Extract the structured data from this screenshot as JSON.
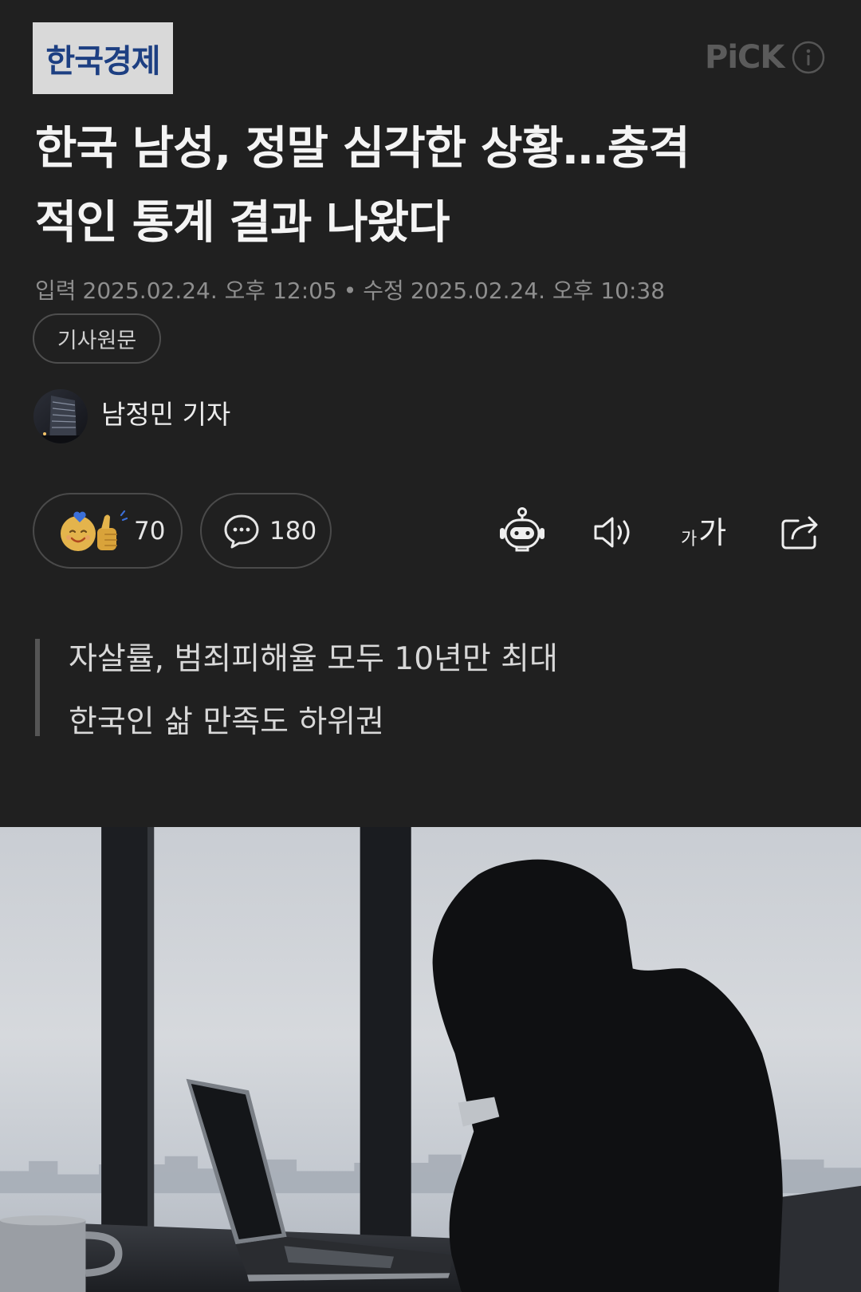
{
  "press": {
    "name": "한국경제"
  },
  "pick": {
    "label": "PiCK"
  },
  "article": {
    "title_lines": [
      "한국 남성, 정말 심각한 상황…충격",
      "적인 통계 결과 나왔다"
    ],
    "input_label": "입력",
    "input_datetime": "2025.02.24. 오후 12:05",
    "separator": "•",
    "modified_label": "수정",
    "modified_datetime": "2025.02.24. 오후 10:38",
    "original_article_label": "기사원문",
    "subtitle_lines": [
      "자살률, 범죄피해율 모두 10년만 최대",
      "한국인 삶 만족도 하위권"
    ]
  },
  "reporter": {
    "name": "남정민 기자"
  },
  "toolbar": {
    "reaction_count": "70",
    "comment_count": "180",
    "font_size_small": "가",
    "font_size_large": "가"
  },
  "icons": {
    "pick_info": "info-icon",
    "reaction": "reaction-emoji-icon",
    "comment": "comment-icon",
    "ai_summary": "robot-icon",
    "read_aloud": "speaker-icon",
    "font_size": "font-size-icon",
    "share": "share-icon"
  },
  "colors": {
    "background": "#202020",
    "text_primary": "#f4f4f4",
    "text_secondary": "#8e8e8e",
    "logo_text": "#1d3f82",
    "logo_background": "#d9d9d9",
    "border": "#4a4a4a",
    "reaction_yellow": "#e4b44c",
    "reaction_heart": "#3b6fd8"
  }
}
